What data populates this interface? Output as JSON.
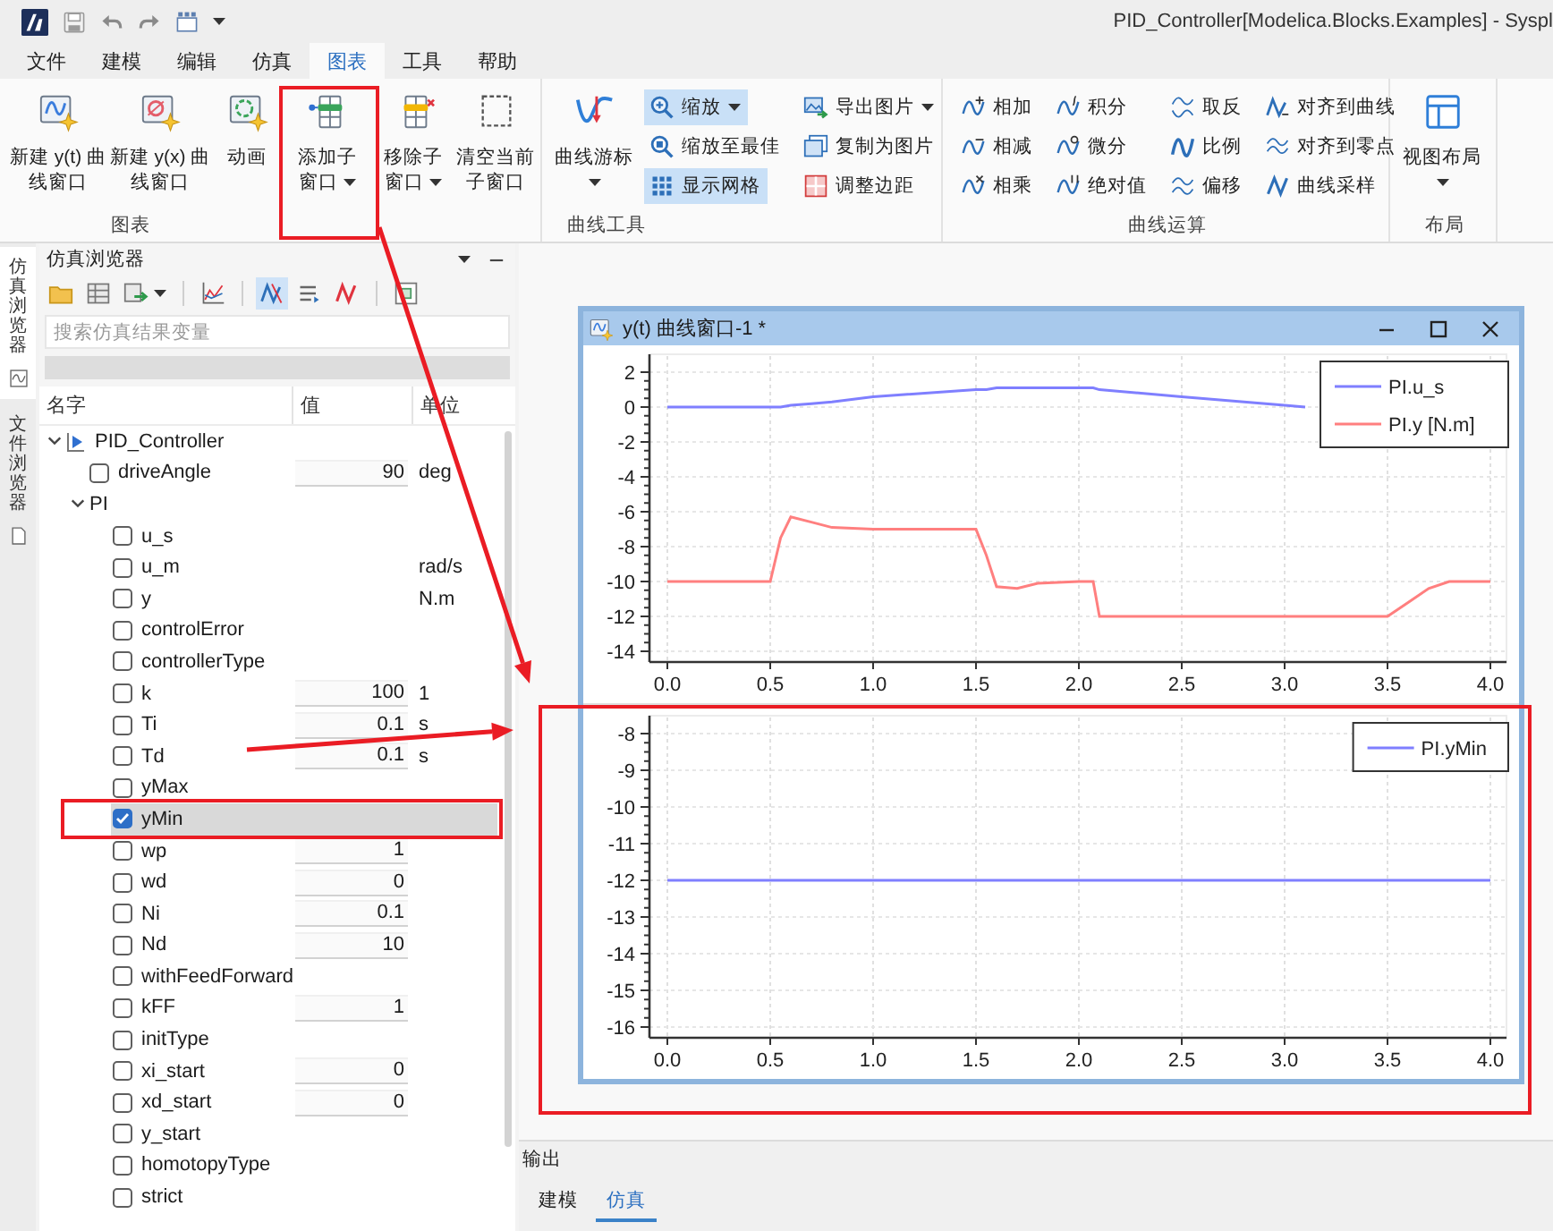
{
  "app": {
    "title": "PID_Controller[Modelica.Blocks.Examples] - Syspl"
  },
  "menu_tabs": [
    {
      "label": "文件",
      "selected": false
    },
    {
      "label": "建模",
      "selected": false
    },
    {
      "label": "编辑",
      "selected": false
    },
    {
      "label": "仿真",
      "selected": false
    },
    {
      "label": "图表",
      "selected": true
    },
    {
      "label": "工具",
      "selected": false
    },
    {
      "label": "帮助",
      "selected": false
    }
  ],
  "ribbon": {
    "groups": [
      {
        "label": "图表",
        "items": [
          {
            "kind": "large",
            "label": "新建 y(t) 曲线窗口",
            "dropdown": false
          },
          {
            "kind": "large",
            "label": "新建 y(x) 曲线窗口",
            "dropdown": false
          },
          {
            "kind": "large",
            "label": "动画",
            "dropdown": false
          },
          {
            "kind": "large",
            "label": "添加子窗口",
            "dropdown": true
          },
          {
            "kind": "large",
            "label": "移除子窗口",
            "dropdown": true
          },
          {
            "kind": "large",
            "label": "清空当前子窗口",
            "dropdown": false
          }
        ]
      },
      {
        "label": "曲线工具",
        "items": [
          {
            "kind": "large",
            "label": "曲线游标",
            "dropdown": true
          },
          {
            "kind": "small",
            "label": "缩放",
            "dropdown": true,
            "on": true
          },
          {
            "kind": "small",
            "label": "缩放至最佳",
            "dropdown": false,
            "on": false
          },
          {
            "kind": "small",
            "label": "显示网格",
            "dropdown": false,
            "on": true
          },
          {
            "kind": "small",
            "label": "导出图片",
            "dropdown": true,
            "on": false
          },
          {
            "kind": "small",
            "label": "复制为图片",
            "dropdown": false,
            "on": false
          },
          {
            "kind": "small",
            "label": "调整边距",
            "dropdown": false,
            "on": false
          }
        ]
      },
      {
        "label": "曲线运算",
        "items": [
          {
            "kind": "small",
            "label": "相加",
            "dropdown": false
          },
          {
            "kind": "small",
            "label": "相减",
            "dropdown": false
          },
          {
            "kind": "small",
            "label": "相乘",
            "dropdown": false
          },
          {
            "kind": "small",
            "label": "积分",
            "dropdown": false
          },
          {
            "kind": "small",
            "label": "微分",
            "dropdown": false
          },
          {
            "kind": "small",
            "label": "绝对值",
            "dropdown": false
          },
          {
            "kind": "small",
            "label": "取反",
            "dropdown": false
          },
          {
            "kind": "small",
            "label": "比例",
            "dropdown": false
          },
          {
            "kind": "small",
            "label": "偏移",
            "dropdown": false
          },
          {
            "kind": "small",
            "label": "对齐到曲线",
            "dropdown": false
          },
          {
            "kind": "small",
            "label": "对齐到零点",
            "dropdown": false
          },
          {
            "kind": "small",
            "label": "曲线采样",
            "dropdown": false
          }
        ]
      },
      {
        "label": "布局",
        "items": [
          {
            "kind": "large",
            "label": "视图布局",
            "dropdown": true
          }
        ]
      }
    ]
  },
  "side_tabs": [
    {
      "label": "仿真浏览器",
      "selected": true
    },
    {
      "label": "文件浏览器",
      "selected": false
    }
  ],
  "browser": {
    "title": "仿真浏览器",
    "toolbar": [
      [
        {
          "on": false,
          "dropdown": false
        },
        {
          "on": false,
          "dropdown": false
        },
        {
          "on": false,
          "dropdown": true
        }
      ],
      [
        {
          "on": false,
          "dropdown": false
        }
      ],
      [
        {
          "on": true,
          "dropdown": false
        },
        {
          "on": false,
          "dropdown": false
        },
        {
          "on": false,
          "dropdown": false
        }
      ],
      [
        {
          "on": false,
          "dropdown": false
        }
      ]
    ],
    "search": {
      "placeholder": "搜索仿真结果变量"
    },
    "columns": [
      "名字",
      "值",
      "单位"
    ],
    "tree": [
      {
        "kind": "model",
        "name": "PID_Controller",
        "expanded": true,
        "selected": false,
        "children": [
          {
            "kind": "variable",
            "name": "driveAngle",
            "checked": false,
            "selected": false,
            "value": "90",
            "unit": "deg"
          },
          {
            "kind": "component",
            "name": "PI",
            "expanded": true,
            "selected": false,
            "children": [
              {
                "kind": "variable",
                "name": "u_s",
                "checked": false,
                "selected": false
              },
              {
                "kind": "variable",
                "name": "u_m",
                "checked": false,
                "selected": false,
                "unit": "rad/s"
              },
              {
                "kind": "variable",
                "name": "y",
                "checked": false,
                "selected": false,
                "unit": "N.m"
              },
              {
                "kind": "variable",
                "name": "controlError",
                "checked": false,
                "selected": false
              },
              {
                "kind": "variable",
                "name": "controllerType",
                "checked": false,
                "selected": false
              },
              {
                "kind": "variable",
                "name": "k",
                "checked": false,
                "selected": false,
                "value": "100",
                "unit": "1"
              },
              {
                "kind": "variable",
                "name": "Ti",
                "checked": false,
                "selected": false,
                "value": "0.1",
                "unit": "s"
              },
              {
                "kind": "variable",
                "name": "Td",
                "checked": false,
                "selected": false,
                "value": "0.1",
                "unit": "s"
              },
              {
                "kind": "variable",
                "name": "yMax",
                "checked": false,
                "selected": false
              },
              {
                "kind": "variable",
                "name": "yMin",
                "checked": true,
                "selected": true
              },
              {
                "kind": "variable",
                "name": "wp",
                "checked": false,
                "selected": false,
                "value": "1"
              },
              {
                "kind": "variable",
                "name": "wd",
                "checked": false,
                "selected": false,
                "value": "0"
              },
              {
                "kind": "variable",
                "name": "Ni",
                "checked": false,
                "selected": false,
                "value": "0.1"
              },
              {
                "kind": "variable",
                "name": "Nd",
                "checked": false,
                "selected": false,
                "value": "10"
              },
              {
                "kind": "variable",
                "name": "withFeedForward",
                "checked": false,
                "selected": false
              },
              {
                "kind": "variable",
                "name": "kFF",
                "checked": false,
                "selected": false,
                "value": "1"
              },
              {
                "kind": "variable",
                "name": "initType",
                "checked": false,
                "selected": false
              },
              {
                "kind": "variable",
                "name": "xi_start",
                "checked": false,
                "selected": false,
                "value": "0"
              },
              {
                "kind": "variable",
                "name": "xd_start",
                "checked": false,
                "selected": false,
                "value": "0"
              },
              {
                "kind": "variable",
                "name": "y_start",
                "checked": false,
                "selected": false
              },
              {
                "kind": "variable",
                "name": "homotopyType",
                "checked": false,
                "selected": false
              },
              {
                "kind": "variable",
                "name": "strict",
                "checked": false,
                "selected": false
              }
            ]
          }
        ]
      }
    ]
  },
  "plot_window": {
    "title": "y(t) 曲线窗口-1 *",
    "subplots": [
      {
        "chart_data": {
          "type": "line",
          "x": [
            0,
            0.5,
            0.55,
            0.6,
            0.7,
            0.8,
            1.0,
            1.5,
            1.55,
            1.6,
            1.7,
            1.8,
            2.0,
            2.07,
            2.1,
            2.5,
            3.0,
            3.1,
            3.5,
            3.6,
            3.7,
            3.8,
            4.0
          ],
          "series": [
            {
              "name": "PI.u_s",
              "color": "#7f7fff",
              "values": [
                0,
                0,
                0,
                0.1,
                0.2,
                0.3,
                0.6,
                1,
                1,
                1.1,
                1.1,
                1.1,
                1.1,
                1.1,
                1,
                0.6,
                0.1,
                0,
                null,
                null,
                null,
                null,
                null
              ]
            },
            {
              "name": "PI.y [N.m]",
              "color": "#ff7f7f",
              "values": [
                -10,
                -10,
                -7.5,
                -6.3,
                -6.6,
                -6.9,
                -7,
                -7,
                -8.5,
                -10.3,
                -10.4,
                -10.1,
                -10,
                -10,
                -12,
                -12,
                -12,
                -12,
                -12,
                -11.2,
                -10.4,
                -10,
                -10
              ]
            }
          ],
          "xlim": [
            0,
            4
          ],
          "ylim": [
            -14,
            2
          ],
          "xticks": [
            {
              "value": 0,
              "label": "0.0"
            },
            {
              "value": 0.5,
              "label": "0.5"
            },
            {
              "value": 1,
              "label": "1.0"
            },
            {
              "value": 1.5,
              "label": "1.5"
            },
            {
              "value": 2,
              "label": "2.0"
            },
            {
              "value": 2.5,
              "label": "2.5"
            },
            {
              "value": 3,
              "label": "3.0"
            },
            {
              "value": 3.5,
              "label": "3.5"
            },
            {
              "value": 4,
              "label": "4.0"
            }
          ],
          "yticks": [
            2,
            0,
            -2,
            -4,
            -6,
            -8,
            -10,
            -12,
            -14
          ],
          "grid": true,
          "legend": true
        }
      },
      {
        "chart_data": {
          "type": "line",
          "x": [
            0,
            4
          ],
          "series": [
            {
              "name": "PI.yMin",
              "color": "#7f7fff",
              "values": [
                -12,
                -12
              ]
            }
          ],
          "xlim": [
            0,
            4
          ],
          "ylim": [
            -16,
            -8
          ],
          "xticks": [
            {
              "value": 0,
              "label": "0.0"
            },
            {
              "value": 0.5,
              "label": "0.5"
            },
            {
              "value": 1,
              "label": "1.0"
            },
            {
              "value": 1.5,
              "label": "1.5"
            },
            {
              "value": 2,
              "label": "2.0"
            },
            {
              "value": 2.5,
              "label": "2.5"
            },
            {
              "value": 3,
              "label": "3.0"
            },
            {
              "value": 3.5,
              "label": "3.5"
            },
            {
              "value": 4,
              "label": "4.0"
            }
          ],
          "yticks": [
            -8,
            -9,
            -10,
            -11,
            -12,
            -13,
            -14,
            -15,
            -16
          ],
          "grid": true,
          "legend": true
        }
      }
    ]
  },
  "output_panel": {
    "title": "输出",
    "tabs": [
      {
        "label": "建模",
        "selected": false
      },
      {
        "label": "仿真",
        "selected": true
      }
    ]
  }
}
